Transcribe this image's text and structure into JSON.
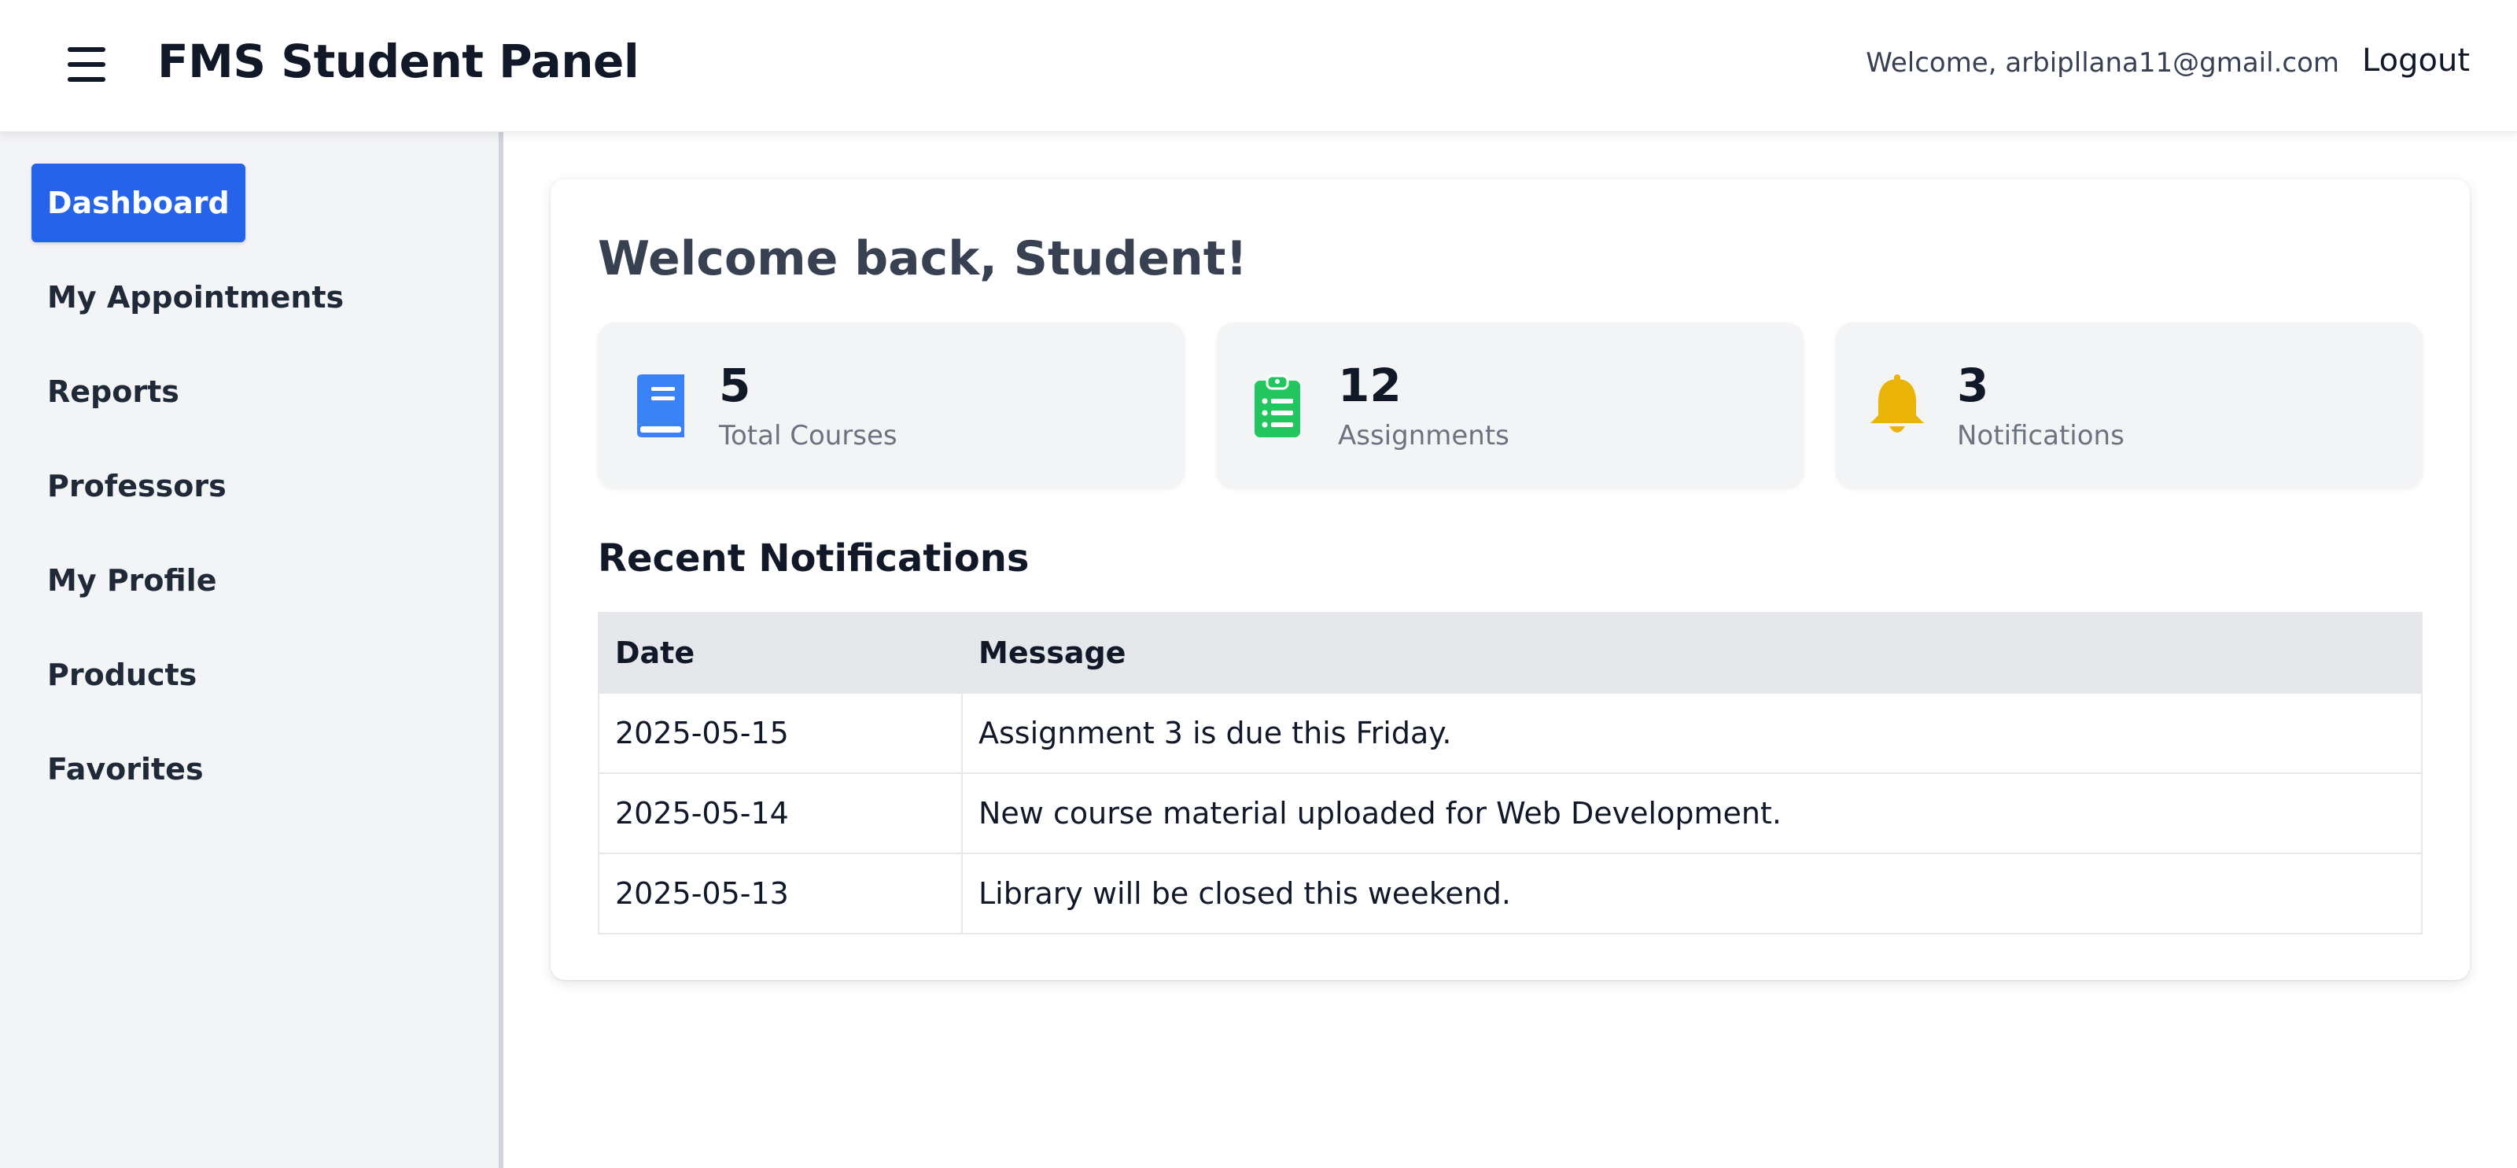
{
  "header": {
    "title": "FMS Student Panel",
    "welcome_text": "Welcome, arbipllana11@gmail.com",
    "logout_label": "Logout"
  },
  "sidebar": {
    "items": [
      {
        "label": "Dashboard",
        "active": true
      },
      {
        "label": "My Appointments",
        "active": false
      },
      {
        "label": "Reports",
        "active": false
      },
      {
        "label": "Professors",
        "active": false
      },
      {
        "label": "My Profile",
        "active": false
      },
      {
        "label": "Products",
        "active": false
      },
      {
        "label": "Favorites",
        "active": false
      }
    ]
  },
  "main": {
    "title": "Welcome back, Student!",
    "stats": [
      {
        "value": "5",
        "label": "Total Courses",
        "icon": "book-icon",
        "color": "#3b82f6"
      },
      {
        "value": "12",
        "label": "Assignments",
        "icon": "clipboard-list-icon",
        "color": "#22c55e"
      },
      {
        "value": "3",
        "label": "Notifications",
        "icon": "bell-icon",
        "color": "#eab308"
      }
    ],
    "notifications": {
      "title": "Recent Notifications",
      "columns": [
        "Date",
        "Message"
      ],
      "rows": [
        {
          "date": "2025-05-15",
          "message": "Assignment 3 is due this Friday."
        },
        {
          "date": "2025-05-14",
          "message": "New course material uploaded for Web Development."
        },
        {
          "date": "2025-05-13",
          "message": "Library will be closed this weekend."
        }
      ]
    }
  },
  "colors": {
    "accent": "#2563eb",
    "sidebar_bg": "#f3f4f6",
    "card_bg": "#f3f4f6",
    "table_header_bg": "#e5e7eb"
  }
}
